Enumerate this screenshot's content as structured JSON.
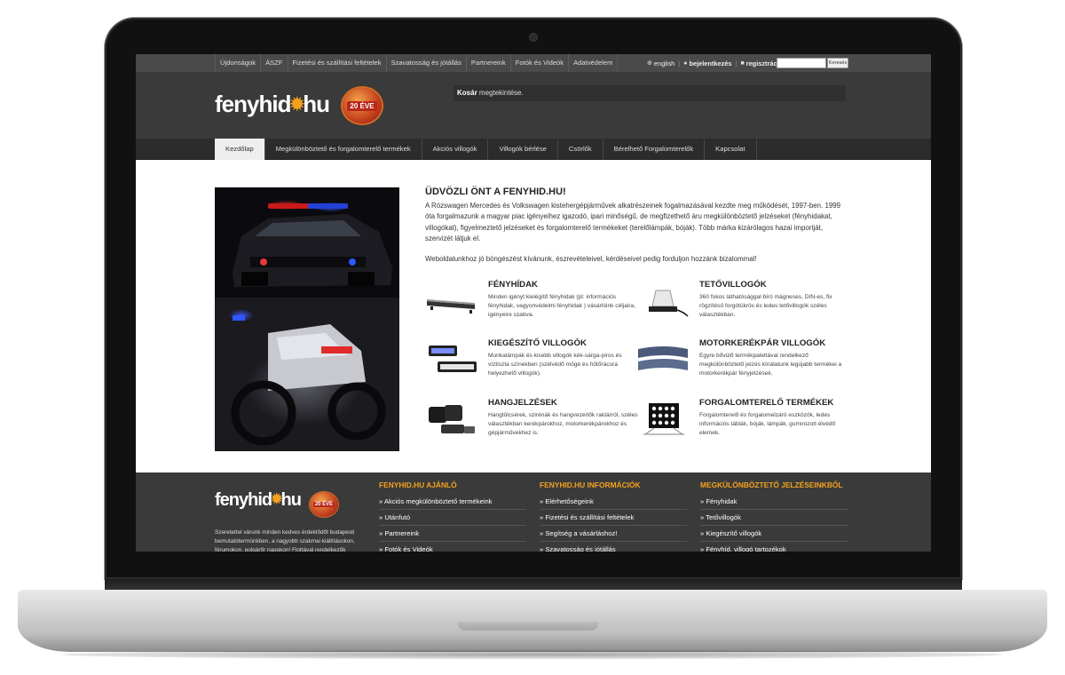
{
  "topbar": {
    "nav": [
      "Újdonságok",
      "ÁSZF",
      "Fizetési és szállítási feltételek",
      "Szavatosság és jótállás",
      "Partnereink",
      "Fotók és Videók",
      "Adatvédelem"
    ],
    "language": "english",
    "login": "bejelentkezés",
    "register": "regisztráció",
    "search_button": "Keresés"
  },
  "header": {
    "logo_left": "fenyhid",
    "logo_right": "hu",
    "badge": "20 ÉVE",
    "cart_bold": "Kosár",
    "cart_rest": "megtekintése."
  },
  "mainnav": [
    "Kezdőlap",
    "Megkülönböztető és forgalomterelő termékek",
    "Akciós villogók",
    "Villogók bérlése",
    "Csörlők",
    "Bérelhető Forgalomterelők",
    "Kapcsolat"
  ],
  "intro": {
    "title": "ÜDVÖZLI ÖNT A FENYHID.HU!",
    "p1": "A Rózswagen Mercedes és Volkswagen kistehergépjárművek alkatrészeinek fogalmazásával kezdte meg működését, 1997-ben. 1999 óta forgalmazunk a magyar piac igényeihez igazodó, ipari minőségű, de megfizethető áru megkülönböztető jelzéseket (fényhidakat, villogókat), figyelmeztető jelzéseket és forgalomterelő termékeket (terelőlámpák, bóják). Több márka kizárólagos hazai importját, szervizét látjuk el.",
    "p2": "Weboldalunkhoz jó böngészést kívánunk, észrevételeivel, kérdéseivel pedig forduljon hozzánk bizalommal!"
  },
  "categories": [
    {
      "title": "FÉNYHÍDAK",
      "desc": "Minden igényt kielégítő fényhidak (pl: információs fényhidak, vagyonvédelmi fényhidak ) vásárlóink céljaira, igényeire szabva."
    },
    {
      "title": "TETŐVILLOGÓK",
      "desc": "360 fokos láthatósággal bíró mágneses, DIN-es, fix rögzítésű forgótükrös és ledes tetővillogók széles választékban."
    },
    {
      "title": "KIEGÉSZÍTŐ VILLOGÓK",
      "desc": "Munkalámpák és kisebb villogók kék-sárga-piros és víztiszta színekben (szélvédő mögé és hűtőrácsra helyezhető villogók)."
    },
    {
      "title": "MOTORKERÉKPÁR VILLOGÓK",
      "desc": "Egyre bővülő termékpalettával rendelkező megkülönböztető jelzés kínálatunk legújabb termékei a motorkerékpár fényjelzések."
    },
    {
      "title": "HANGJELZÉSEK",
      "desc": "Hangtölcsérek, szirénák és hangvezérlők raktárról, széles választékban kerékpárokhoz, motorkerékpárokhoz és gépjárművekhez is."
    },
    {
      "title": "FORGALOMTERELŐ TERMÉKEK",
      "desc": "Forgalomterelő és forgalomelzáró eszközök, ledes információs táblák, bóják, lámpák, gumirozott élvédő elemek."
    }
  ],
  "footer": {
    "logo_left": "fenyhid",
    "logo_right": "hu",
    "badge": "20 ÉVE",
    "about": "Szeretettel várunk minden kedves érdeklődőt budapesti bemutatótermünkben, a nagyobb szakmai kiállításokon, fórumokon, polgárőr napokon! Flottával rendelkezők",
    "col1": {
      "title": "FENYHID.HU AJÁNLÓ",
      "links": [
        "» Akciós megkülönböztető termékeink",
        "» Utánfutó",
        "» Partnereink",
        "» Fotók és Videók"
      ]
    },
    "col2": {
      "title": "FENYHID.HU INFORMÁCIÓK",
      "links": [
        "» Elérhetőségeink",
        "» Fizetési és szállítási feltételek",
        "» Segítség a vásárláshoz!",
        "» Szavatosság és jótállás"
      ]
    },
    "col3": {
      "title": "MEGKÜLÖNBÖZTETŐ JELZÉSEINKBŐL",
      "links": [
        "» Fényhidak",
        "» Tetővillogók",
        "» Kiegészítő villogók",
        "» Fényhíd, villogó tartozékok"
      ]
    }
  },
  "colors": {
    "accent": "#f4a21e",
    "header_bg": "#3a3a3a",
    "nav_bg": "#2c2c2c"
  }
}
